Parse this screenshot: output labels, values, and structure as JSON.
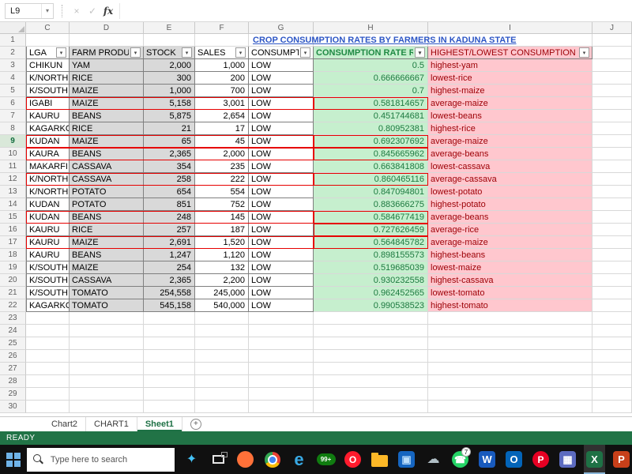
{
  "formula_bar": {
    "name_box": "L9",
    "caret": "▾",
    "cancel": "×",
    "enter": "✓",
    "fx": "fx"
  },
  "sheet": {
    "title": "CROP CONSUMPTION RATES BY FARMERS IN KADUNA STATE",
    "columns": [
      "C",
      "D",
      "E",
      "F",
      "G",
      "H",
      "I",
      "J"
    ],
    "filter_caret": "▾",
    "active_row": 9,
    "header_row": {
      "number": 2,
      "cells": [
        {
          "col": "c",
          "label": "LGA",
          "style": "plain"
        },
        {
          "col": "d",
          "label": "FARM PRODUCE",
          "style": "gray"
        },
        {
          "col": "e",
          "label": "STOCK",
          "style": "gray"
        },
        {
          "col": "f",
          "label": "SALES",
          "style": "plain"
        },
        {
          "col": "g",
          "label": "CONSUMPTION",
          "style": "plain"
        },
        {
          "col": "h",
          "label": "CONSUMPTION RATE RATIO",
          "style": "green"
        },
        {
          "col": "i",
          "label": "HIGHEST/LOWEST CONSUMPTION RATE",
          "style": "pink"
        }
      ]
    },
    "data_rows": [
      {
        "n": 3,
        "lga": "CHIKUN",
        "produce": "YAM",
        "stock": "2,000",
        "sales": "1,000",
        "consumption": "LOW",
        "rate": "0.5",
        "category": "highest-yam",
        "red_box": false,
        "red_box_h": false
      },
      {
        "n": 4,
        "lga": "K/NORTH",
        "produce": "RICE",
        "stock": "300",
        "sales": "200",
        "consumption": "LOW",
        "rate": "0.666666667",
        "category": "lowest-rice",
        "red_box": false,
        "red_box_h": false
      },
      {
        "n": 5,
        "lga": "K/SOUTH",
        "produce": "MAIZE",
        "stock": "1,000",
        "sales": "700",
        "consumption": "LOW",
        "rate": "0.7",
        "category": "highest-maize",
        "red_box": false,
        "red_box_h": false
      },
      {
        "n": 6,
        "lga": "IGABI",
        "produce": "MAIZE",
        "stock": "5,158",
        "sales": "3,001",
        "consumption": "LOW",
        "rate": "0.581814657",
        "category": "average-maize",
        "red_box": true,
        "red_box_h": true
      },
      {
        "n": 7,
        "lga": "KAURU",
        "produce": "BEANS",
        "stock": "5,875",
        "sales": "2,654",
        "consumption": "LOW",
        "rate": "0.451744681",
        "category": "lowest-beans",
        "red_box": false,
        "red_box_h": false
      },
      {
        "n": 8,
        "lga": "KAGARKO",
        "produce": "RICE",
        "stock": "21",
        "sales": "17",
        "consumption": "LOW",
        "rate": "0.80952381",
        "category": "highest-rice",
        "red_box": false,
        "red_box_h": false
      },
      {
        "n": 9,
        "lga": "KUDAN",
        "produce": "MAIZE",
        "stock": "65",
        "sales": "45",
        "consumption": "LOW",
        "rate": "0.692307692",
        "category": "average-maize",
        "red_box": true,
        "red_box_h": true
      },
      {
        "n": 10,
        "lga": "KAURA",
        "produce": "BEANS",
        "stock": "2,365",
        "sales": "2,000",
        "consumption": "LOW",
        "rate": "0.845665962",
        "category": "average-beans",
        "red_box": true,
        "red_box_h": true
      },
      {
        "n": 11,
        "lga": "MAKARFI",
        "produce": "CASSAVA",
        "stock": "354",
        "sales": "235",
        "consumption": "LOW",
        "rate": "0.663841808",
        "category": "lowest-cassava",
        "red_box": false,
        "red_box_h": false
      },
      {
        "n": 12,
        "lga": "K/NORTH",
        "produce": "CASSAVA",
        "stock": "258",
        "sales": "222",
        "consumption": "LOW",
        "rate": "0.860465116",
        "category": "average-cassava",
        "red_box": true,
        "red_box_h": true
      },
      {
        "n": 13,
        "lga": "K/NORTH",
        "produce": "POTATO",
        "stock": "654",
        "sales": "554",
        "consumption": "LOW",
        "rate": "0.847094801",
        "category": "lowest-potato",
        "red_box": false,
        "red_box_h": false
      },
      {
        "n": 14,
        "lga": "KUDAN",
        "produce": "POTATO",
        "stock": "851",
        "sales": "752",
        "consumption": "LOW",
        "rate": "0.883666275",
        "category": "highest-potato",
        "red_box": false,
        "red_box_h": false
      },
      {
        "n": 15,
        "lga": "KUDAN",
        "produce": "BEANS",
        "stock": "248",
        "sales": "145",
        "consumption": "LOW",
        "rate": "0.584677419",
        "category": "average-beans",
        "red_box": true,
        "red_box_h": true
      },
      {
        "n": 16,
        "lga": "KAURU",
        "produce": "RICE",
        "stock": "257",
        "sales": "187",
        "consumption": "LOW",
        "rate": "0.727626459",
        "category": "average-rice",
        "red_box": false,
        "red_box_h": true
      },
      {
        "n": 17,
        "lga": "KAURU",
        "produce": "MAIZE",
        "stock": "2,691",
        "sales": "1,520",
        "consumption": "LOW",
        "rate": "0.564845782",
        "category": "average-maize",
        "red_box": true,
        "red_box_h": true
      },
      {
        "n": 18,
        "lga": "KAURU",
        "produce": "BEANS",
        "stock": "1,247",
        "sales": "1,120",
        "consumption": "LOW",
        "rate": "0.898155573",
        "category": "highest-beans",
        "red_box": false,
        "red_box_h": false
      },
      {
        "n": 19,
        "lga": "K/SOUTH",
        "produce": "MAIZE",
        "stock": "254",
        "sales": "132",
        "consumption": "LOW",
        "rate": "0.519685039",
        "category": "lowest-maize",
        "red_box": false,
        "red_box_h": false
      },
      {
        "n": 20,
        "lga": "K/SOUTH",
        "produce": "CASSAVA",
        "stock": "2,365",
        "sales": "2,200",
        "consumption": "LOW",
        "rate": "0.930232558",
        "category": "highest-cassava",
        "red_box": false,
        "red_box_h": false
      },
      {
        "n": 21,
        "lga": "K/SOUTH",
        "produce": "TOMATO",
        "stock": "254,558",
        "sales": "245,000",
        "consumption": "LOW",
        "rate": "0.962452565",
        "category": "lowest-tomato",
        "red_box": false,
        "red_box_h": false
      },
      {
        "n": 22,
        "lga": "KAGARKO",
        "produce": "TOMATO",
        "stock": "545,158",
        "sales": "540,000",
        "consumption": "LOW",
        "rate": "0.990538523",
        "category": "highest-tomato",
        "red_box": false,
        "red_box_h": false
      }
    ],
    "empty_row_numbers": [
      23,
      24,
      25,
      26,
      27,
      28,
      29,
      30
    ]
  },
  "tabs": {
    "sheets": [
      {
        "label": "Chart2",
        "active": false
      },
      {
        "label": "CHART1",
        "active": false
      },
      {
        "label": "Sheet1",
        "active": true
      }
    ],
    "add_label": "+"
  },
  "status_bar": {
    "mode": "READY"
  },
  "taskbar": {
    "search_placeholder": "Type here to search",
    "icons": [
      {
        "name": "cortana-icon",
        "shape": "glyph",
        "glyph": "✦",
        "fg": "#45c1f5"
      },
      {
        "name": "task-view-icon",
        "shape": "taskview"
      },
      {
        "name": "firefox-icon",
        "shape": "circle",
        "glyph": "",
        "bg": "#ff7139",
        "fg": "#ffffff"
      },
      {
        "name": "chrome-icon",
        "shape": "chrome"
      },
      {
        "name": "edge-icon",
        "shape": "glyph",
        "glyph": "e",
        "fg": "#38a9e4",
        "big": true
      },
      {
        "name": "badge-99-icon",
        "shape": "pill",
        "glyph": "99+",
        "bg": "#107c10",
        "fg": "#ffffff"
      },
      {
        "name": "opera-icon",
        "shape": "circle",
        "glyph": "O",
        "bg": "#ff1b2d",
        "fg": "#ffffff"
      },
      {
        "name": "folder-icon",
        "shape": "folder"
      },
      {
        "name": "photos-icon",
        "shape": "square",
        "glyph": "▣",
        "bg": "#1565c0",
        "fg": "#bbdefb"
      },
      {
        "name": "onedrive-icon",
        "shape": "glyph",
        "glyph": "☁",
        "fg": "#b0bec5"
      },
      {
        "name": "whatsapp-icon",
        "shape": "circle",
        "glyph": "☎",
        "bg": "#25d366",
        "fg": "#ffffff",
        "badge": "7"
      },
      {
        "name": "word-icon",
        "shape": "square",
        "glyph": "W",
        "bg": "#185abd",
        "fg": "#ffffff"
      },
      {
        "name": "outlook-icon",
        "shape": "square",
        "glyph": "O",
        "bg": "#0364b8",
        "fg": "#ffffff"
      },
      {
        "name": "pinterest-icon",
        "shape": "circle",
        "glyph": "P",
        "bg": "#e60023",
        "fg": "#ffffff"
      },
      {
        "name": "store-icon",
        "shape": "square",
        "glyph": "▦",
        "bg": "#5c6bc0",
        "fg": "#ffffff"
      },
      {
        "name": "excel-icon",
        "shape": "square",
        "glyph": "X",
        "bg": "#1e7145",
        "fg": "#ffffff",
        "active": true
      },
      {
        "name": "powerpoint-icon",
        "shape": "square",
        "glyph": "P",
        "bg": "#c8401a",
        "fg": "#ffffff"
      }
    ]
  },
  "colors": {
    "good_bg": "#c6efce",
    "good_text": "#006100",
    "bad_bg": "#ffc7ce",
    "bad_text": "#9c0006",
    "gray_cell": "#d9d9d9",
    "title_blue": "#2d56c5",
    "excel_green": "#217346",
    "red_border": "#e60000"
  }
}
